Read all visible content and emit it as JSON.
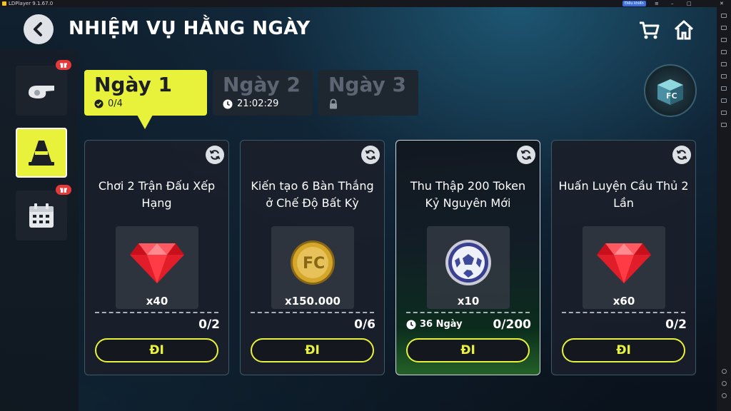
{
  "emulator": {
    "title": "LDPlayer 9.1.67.0",
    "badge": "Điều khiển"
  },
  "header": {
    "title": "NHIỆM VỤ HẰNG NGÀY",
    "icons": [
      "back-arrow-icon",
      "cart-icon",
      "home-icon"
    ]
  },
  "sidebar": {
    "tabs": [
      {
        "name": "whistle",
        "icon": "whistle-icon",
        "badge": "gift-icon",
        "active": false
      },
      {
        "name": "training-cone",
        "icon": "cone-icon",
        "badge": null,
        "active": true
      },
      {
        "name": "calendar",
        "icon": "calendar-icon",
        "badge": "gift-icon",
        "active": false
      }
    ]
  },
  "days": [
    {
      "label": "Ngày 1",
      "sub": "0/4",
      "sub_icon": "check-circle-icon",
      "active": true
    },
    {
      "label": "Ngày 2",
      "sub": "21:02:29",
      "sub_icon": "clock-icon",
      "active": false
    },
    {
      "label": "Ngày 3",
      "sub": "",
      "sub_icon": "lock-icon",
      "active": false
    }
  ],
  "missions": [
    {
      "title": "Chơi 2 Trận Đấu Xếp Hạng",
      "reward_icon": "ruby-gem-icon",
      "reward_qty": "x40",
      "progress": "0/2",
      "timer": "",
      "button": "ĐI"
    },
    {
      "title": "Kiến tạo 6 Bàn Thắng ở Chế Độ Bất Kỳ",
      "reward_icon": "fc-coin-icon",
      "reward_qty": "x150.000",
      "progress": "0/6",
      "timer": "",
      "button": "ĐI"
    },
    {
      "title": "Thu Thập 200 Token Kỷ Nguyên Mới",
      "reward_icon": "ball-token-icon",
      "reward_qty": "x10",
      "progress": "0/200",
      "timer": "36 Ngày",
      "button": "ĐI"
    },
    {
      "title": "Huấn Luyện Cầu Thủ 2 Lần",
      "reward_icon": "ruby-gem-icon",
      "reward_qty": "x60",
      "progress": "0/2",
      "timer": "",
      "button": "ĐI"
    }
  ],
  "colors": {
    "accent": "#e9f23a",
    "gift_badge": "#e63a3a",
    "card_border": "#3b5a66",
    "ruby": "#e11d2a",
    "coin": "#d4a62a"
  }
}
